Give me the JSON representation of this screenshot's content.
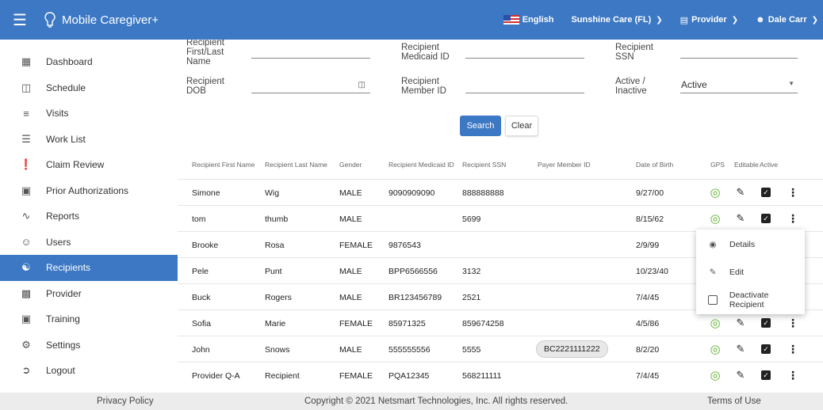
{
  "header": {
    "app_name": "Mobile Caregiver+",
    "language": "English",
    "agency": "Sunshine Care (FL)",
    "role": "Provider",
    "user": "Dale Carr"
  },
  "sidebar": {
    "items": [
      {
        "label": "Dashboard",
        "icon": "dashboard-icon"
      },
      {
        "label": "Schedule",
        "icon": "calendar-icon"
      },
      {
        "label": "Visits",
        "icon": "filter-icon"
      },
      {
        "label": "Work List",
        "icon": "list-icon"
      },
      {
        "label": "Claim Review",
        "icon": "alert-icon"
      },
      {
        "label": "Prior Authorizations",
        "icon": "calendar-event-icon"
      },
      {
        "label": "Reports",
        "icon": "trending-icon"
      },
      {
        "label": "Users",
        "icon": "users-icon"
      },
      {
        "label": "Recipients",
        "icon": "recipients-icon"
      },
      {
        "label": "Provider",
        "icon": "clipboard-icon"
      },
      {
        "label": "Training",
        "icon": "training-icon"
      },
      {
        "label": "Settings",
        "icon": "gear-icon"
      },
      {
        "label": "Logout",
        "icon": "logout-icon"
      }
    ],
    "active": "Recipients"
  },
  "search_form": {
    "name_label": "Recipient First/Last Name",
    "medicaid_label": "Recipient Medicaid ID",
    "ssn_label": "Recipient SSN",
    "dob_label": "Recipient DOB",
    "member_label": "Recipient Member ID",
    "active_label": "Active / Inactive",
    "active_value": "Active",
    "search_button": "Search",
    "clear_button": "Clear"
  },
  "table": {
    "columns": [
      "Recipient First Name",
      "Recipient Last Name",
      "Gender",
      "Recipient Medicaid ID",
      "Recipient SSN",
      "Payer Member ID",
      "Date of Birth",
      "GPS",
      "Editable",
      "Active"
    ],
    "rows": [
      {
        "first": "Simone",
        "last": "Wig",
        "gender": "MALE",
        "medicaid": "9090909090",
        "ssn": "888888888",
        "payer": "",
        "dob": "9/27/00"
      },
      {
        "first": "tom",
        "last": "thumb",
        "gender": "MALE",
        "medicaid": "",
        "ssn": "5699",
        "payer": "",
        "dob": "8/15/62"
      },
      {
        "first": "Brooke",
        "last": "Rosa",
        "gender": "FEMALE",
        "medicaid": "9876543",
        "ssn": "",
        "payer": "",
        "dob": "2/9/99"
      },
      {
        "first": "Pele",
        "last": "Punt",
        "gender": "MALE",
        "medicaid": "BPP6566556",
        "ssn": "3132",
        "payer": "",
        "dob": "10/23/40"
      },
      {
        "first": "Buck",
        "last": "Rogers",
        "gender": "MALE",
        "medicaid": "BR123456789",
        "ssn": "2521",
        "payer": "",
        "dob": "7/4/45"
      },
      {
        "first": "Sofia",
        "last": "Marie",
        "gender": "FEMALE",
        "medicaid": "85971325",
        "ssn": "859674258",
        "payer": "",
        "dob": "4/5/86"
      },
      {
        "first": "John",
        "last": "Snows",
        "gender": "MALE",
        "medicaid": "555555556",
        "ssn": "5555",
        "payer": "BC2221111222",
        "dob": "8/2/20"
      },
      {
        "first": "Provider Q-A",
        "last": "Recipient",
        "gender": "FEMALE",
        "medicaid": "PQA12345",
        "ssn": "568211111",
        "payer": "",
        "dob": "7/4/45"
      }
    ]
  },
  "context_menu": {
    "details": "Details",
    "edit": "Edit",
    "deactivate": "Deactivate Recipient"
  },
  "footer": {
    "privacy": "Privacy Policy",
    "copyright": "Copyright © 2021 Netsmart Technologies, Inc. All rights reserved.",
    "terms": "Terms of Use"
  },
  "colors": {
    "primary": "#3c78c3",
    "gps_green": "#5ab02a"
  }
}
